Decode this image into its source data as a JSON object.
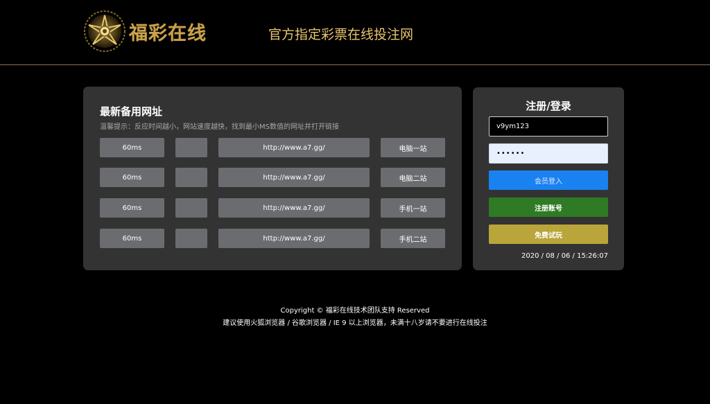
{
  "header": {
    "logo_text": "福彩在线",
    "slogan": "官方指定彩票在线投注网"
  },
  "mirrors": {
    "title": "最新备用网址",
    "tip": "温馨提示：反应时间越小，网站速度越快，找到最小MS数值的网址并打开链接",
    "rows": [
      {
        "ms": "60ms",
        "extra": "",
        "url": "http://www.a7.gg/",
        "site": "电脑一站"
      },
      {
        "ms": "60ms",
        "extra": "",
        "url": "http://www.a7.gg/",
        "site": "电脑二站"
      },
      {
        "ms": "60ms",
        "extra": "",
        "url": "http://www.a7.gg/",
        "site": "手机一站"
      },
      {
        "ms": "60ms",
        "extra": "",
        "url": "http://www.a7.gg/",
        "site": "手机二站"
      }
    ]
  },
  "login": {
    "title": "注册/登录",
    "username": "v9ym123",
    "password_mask": "••••••",
    "login_label": "会员登入",
    "register_label": "注册账号",
    "trial_label": "免费试玩",
    "datetime": "2020 / 08 / 06 / 15:26:07"
  },
  "footer": {
    "copyright": "Copyright © 福彩在线技术团队支持 Reserved",
    "notice": "建议使用火狐浏览器 / 谷歌浏览器 / IE 9 以上浏览器，未满十八岁请不要进行在线投注"
  },
  "colors": {
    "accent_gold": "#c9a24a",
    "login_blue": "#1a82f0",
    "register_green": "#2f7a24",
    "trial_gold": "#b9a53a"
  },
  "icons": {
    "logo": "sun-emblem-icon"
  }
}
